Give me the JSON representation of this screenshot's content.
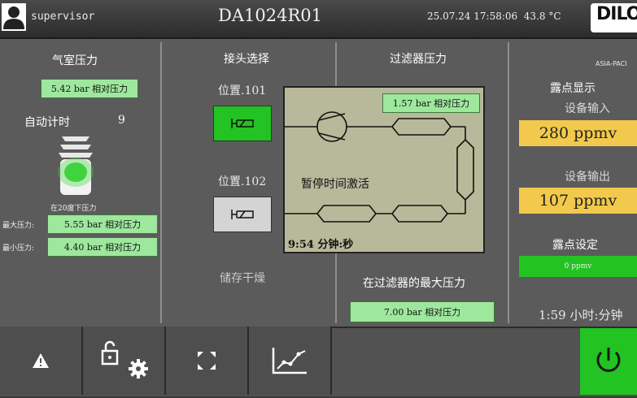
{
  "header": {
    "user": "supervisor",
    "machine_id": "DA1024R01",
    "datetime": "25.07.24 17:58:06",
    "temperature": "43.8 °C",
    "logo": "DILO",
    "logo_sub": "ASIA-PACI"
  },
  "chamber": {
    "title": "气室压力",
    "pressure": "5.42 bar 相对压力",
    "auto_timer_label": "自动计时",
    "auto_timer_value": "9",
    "at20_label": "在20度下压力",
    "max_label": "最大压力:",
    "max_value": "5.55 bar 相对压力",
    "min_label": "最小压力:",
    "min_value": "4.40 bar 相对压力"
  },
  "connector": {
    "title": "接头选择",
    "pos1_label": "位置.101",
    "pos2_label": "位置.102",
    "storage_label": "储存干燥"
  },
  "filter": {
    "title": "过滤器压力",
    "pressure": "1.57 bar 相对压力",
    "pause_label": "暂停时间激活",
    "timer": "9:54 分钟:秒",
    "max_label": "在过滤器的最大压力",
    "max_value": "7.00 bar 相对压力"
  },
  "dewpoint": {
    "title": "露点显示",
    "input_label": "设备输入",
    "input_value": "280 ppmv",
    "output_label": "设备输出",
    "output_value": "107 ppmv",
    "setting_label": "露点设定",
    "setting_value": "0 ppmv",
    "timer": "1:59 小时:分钟"
  },
  "colors": {
    "green_active": "#22c322",
    "green_field": "#9ee89e",
    "yellow_field": "#f2c94c",
    "schematic_bg": "#b8b99a"
  }
}
